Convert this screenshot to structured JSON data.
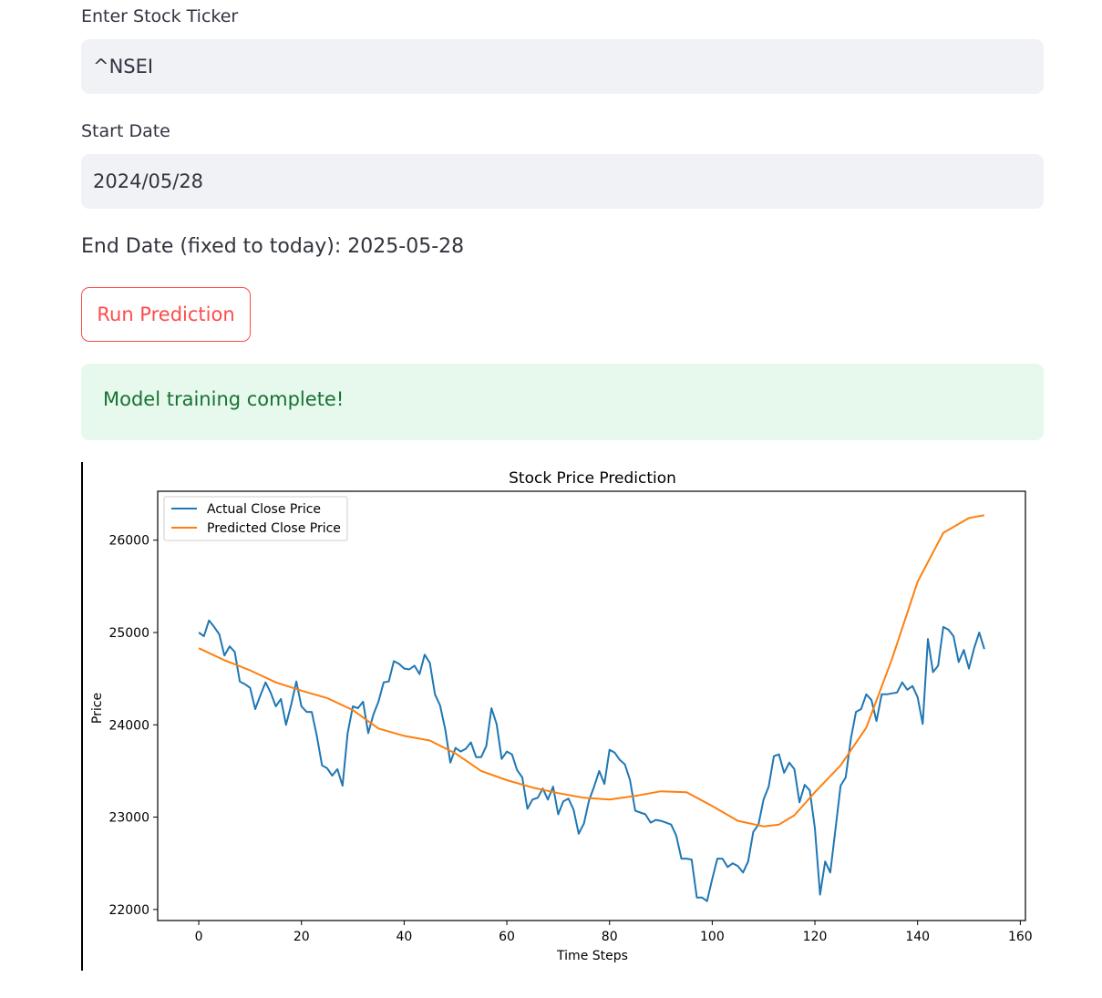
{
  "form": {
    "ticker_label": "Enter Stock Ticker",
    "ticker_value": "^NSEI",
    "start_label": "Start Date",
    "start_value": "2024/05/28",
    "end_date_text": "End Date (fixed to today): 2025-05-28",
    "run_button": "Run Prediction"
  },
  "status": {
    "message": "Model training complete!"
  },
  "colors": {
    "accent": "#ff4b4b",
    "success_text": "#177233",
    "success_bg": "#e7f8ed",
    "actual": "#1f77b4",
    "predicted": "#ff7f0e"
  },
  "chart_data": {
    "type": "line",
    "title": "Stock Price Prediction",
    "xlabel": "Time Steps",
    "ylabel": "Price",
    "xlim": [
      -8,
      161
    ],
    "ylim": [
      21880,
      26530
    ],
    "xticks": [
      0,
      20,
      40,
      60,
      80,
      100,
      120,
      140,
      160
    ],
    "yticks": [
      22000,
      23000,
      24000,
      25000,
      26000
    ],
    "legend_position": "upper-left",
    "series": [
      {
        "name": "Actual Close Price",
        "color": "#1f77b4",
        "x": [
          0,
          1,
          2,
          3,
          4,
          5,
          6,
          7,
          8,
          9,
          10,
          11,
          12,
          13,
          14,
          15,
          16,
          17,
          18,
          19,
          20,
          21,
          22,
          23,
          24,
          25,
          26,
          27,
          28,
          29,
          30,
          31,
          32,
          33,
          34,
          35,
          36,
          37,
          38,
          39,
          40,
          41,
          42,
          43,
          44,
          45,
          46,
          47,
          48,
          49,
          50,
          51,
          52,
          53,
          54,
          55,
          56,
          57,
          58,
          59,
          60,
          61,
          62,
          63,
          64,
          65,
          66,
          67,
          68,
          69,
          70,
          71,
          72,
          73,
          74,
          75,
          76,
          77,
          78,
          79,
          80,
          81,
          82,
          83,
          84,
          85,
          86,
          87,
          88,
          89,
          90,
          91,
          92,
          93,
          94,
          95,
          96,
          97,
          98,
          99,
          100,
          101,
          102,
          103,
          104,
          105,
          106,
          107,
          108,
          109,
          110,
          111,
          112,
          113,
          114,
          115,
          116,
          117,
          118,
          119,
          120,
          121,
          122,
          123,
          124,
          125,
          126,
          127,
          128,
          129,
          130,
          131,
          132,
          133,
          134,
          135,
          136,
          137,
          138,
          139,
          140,
          141,
          142,
          143,
          144,
          145,
          146,
          147,
          148,
          149,
          150,
          151,
          152,
          153
        ],
        "y": [
          25000,
          24960,
          25130,
          25060,
          24980,
          24750,
          24850,
          24790,
          24470,
          24440,
          24400,
          24170,
          24320,
          24460,
          24350,
          24200,
          24280,
          24000,
          24220,
          24470,
          24200,
          24140,
          24140,
          23880,
          23560,
          23530,
          23450,
          23520,
          23340,
          23910,
          24200,
          24180,
          24250,
          23910,
          24110,
          24250,
          24460,
          24470,
          24690,
          24660,
          24610,
          24600,
          24640,
          24550,
          24760,
          24670,
          24330,
          24210,
          23950,
          23590,
          23750,
          23710,
          23740,
          23810,
          23650,
          23650,
          23770,
          24180,
          24010,
          23630,
          23710,
          23680,
          23510,
          23430,
          23090,
          23190,
          23210,
          23310,
          23190,
          23330,
          23030,
          23170,
          23200,
          23080,
          22820,
          22930,
          23180,
          23330,
          23500,
          23360,
          23730,
          23700,
          23620,
          23570,
          23400,
          23070,
          23050,
          23030,
          22940,
          22970,
          22960,
          22940,
          22920,
          22800,
          22550,
          22550,
          22540,
          22130,
          22130,
          22090,
          22330,
          22550,
          22550,
          22460,
          22500,
          22470,
          22400,
          22520,
          22840,
          22920,
          23190,
          23330,
          23660,
          23680,
          23480,
          23590,
          23520,
          23160,
          23350,
          23290,
          22880,
          22160,
          22520,
          22400,
          22870,
          23340,
          23430,
          23850,
          24140,
          24170,
          24330,
          24270,
          24040,
          24330,
          24330,
          24340,
          24350,
          24460,
          24380,
          24420,
          24300,
          24010,
          24930,
          24570,
          24640,
          25060,
          25030,
          24960,
          24680,
          24810,
          24610,
          24830,
          25000,
          24820
        ]
      },
      {
        "name": "Predicted Close Price",
        "color": "#ff7f0e",
        "x": [
          0,
          5,
          10,
          15,
          20,
          25,
          30,
          35,
          40,
          45,
          50,
          55,
          60,
          65,
          70,
          75,
          80,
          85,
          90,
          95,
          100,
          105,
          110,
          113,
          116,
          120,
          125,
          130,
          135,
          140,
          145,
          150,
          153
        ],
        "y": [
          24830,
          24700,
          24590,
          24460,
          24370,
          24290,
          24160,
          23960,
          23880,
          23830,
          23690,
          23500,
          23400,
          23320,
          23260,
          23210,
          23190,
          23230,
          23280,
          23270,
          23120,
          22960,
          22900,
          22920,
          23020,
          23270,
          23560,
          23970,
          24710,
          25550,
          26080,
          26240,
          26270
        ]
      }
    ]
  }
}
